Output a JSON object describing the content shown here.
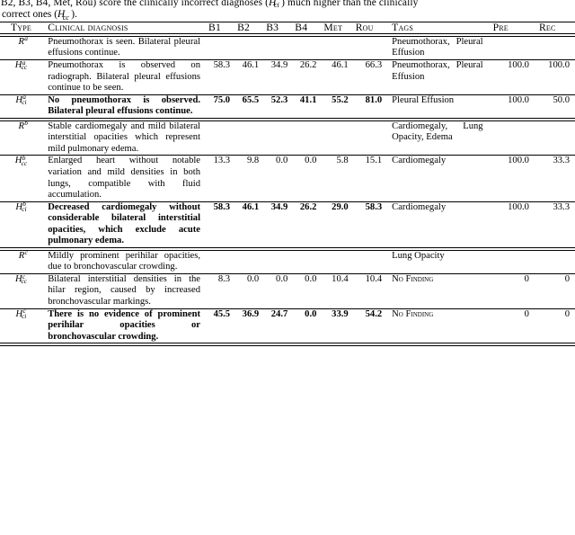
{
  "caption": {
    "line1": "B2, B3, B4, Met, Rou) score the clinically incorrect diagnoses (",
    "line1_sym": "H",
    "line1_sub": "ci",
    "line1_tail": ") much higher than the clinically",
    "line2_head": "correct ones (",
    "line2_sym": "H",
    "line2_sub": "cc",
    "line2_tail": ")."
  },
  "table": {
    "headers": {
      "type": "Type",
      "diagnosis": "Clinical diagnosis",
      "b1": "B1",
      "b2": "B2",
      "b3": "B3",
      "b4": "B4",
      "met": "Met",
      "rou": "Rou",
      "tags": "Tags",
      "pre": "Pre",
      "rec": "Rec"
    },
    "rows": [
      {
        "type_sym": "R",
        "type_sup": "a",
        "type_sub": "",
        "diagnosis": "Pneumothorax is seen. Bilateral pleural effusions continue.",
        "b1": "",
        "b2": "",
        "b3": "",
        "b4": "",
        "met": "",
        "rou": "",
        "tags": "Pneumothorax, Pleural Effusion",
        "pre": "",
        "rec": "",
        "bold": false
      },
      {
        "type_sym": "H",
        "type_sup": "a",
        "type_sub": "cc",
        "diagnosis": "Pneumothorax is observed on radiograph. Bilateral pleural effusions continue to be seen.",
        "b1": "58.3",
        "b2": "46.1",
        "b3": "34.9",
        "b4": "26.2",
        "met": "46.1",
        "rou": "66.3",
        "tags": "Pneumothorax, Pleural Effusion",
        "pre": "100.0",
        "rec": "100.0",
        "bold": false
      },
      {
        "type_sym": "H",
        "type_sup": "a",
        "type_sub": "ci",
        "diagnosis": "No pneumothorax is observed. Bilateral pleural effusions continue.",
        "b1": "75.0",
        "b2": "65.5",
        "b3": "52.3",
        "b4": "41.1",
        "met": "55.2",
        "rou": "81.0",
        "tags": "Pleural Effusion",
        "pre": "100.0",
        "rec": "50.0",
        "bold": true
      },
      {
        "type_sym": "R",
        "type_sup": "b",
        "type_sub": "",
        "diagnosis": "Stable cardiomegaly and mild bilateral interstitial opacities which represent mild pulmonary edema.",
        "b1": "",
        "b2": "",
        "b3": "",
        "b4": "",
        "met": "",
        "rou": "",
        "tags": "Cardiomegaly, Lung Opacity, Edema",
        "pre": "",
        "rec": "",
        "bold": false
      },
      {
        "type_sym": "H",
        "type_sup": "b",
        "type_sub": "cc",
        "diagnosis": "Enlarged heart without notable variation and mild densities in both lungs, compatible with fluid accumulation.",
        "b1": "13.3",
        "b2": "9.8",
        "b3": "0.0",
        "b4": "0.0",
        "met": "5.8",
        "rou": "15.1",
        "tags": "Cardiomegaly",
        "pre": "100.0",
        "rec": "33.3",
        "bold": false
      },
      {
        "type_sym": "H",
        "type_sup": "b",
        "type_sub": "ci",
        "diagnosis": "Decreased cardiomegaly without considerable bilateral interstitial opacities, which exclude acute pulmonary edema.",
        "b1": "58.3",
        "b2": "46.1",
        "b3": "34.9",
        "b4": "26.2",
        "met": "29.0",
        "rou": "58.3",
        "tags": "Cardiomegaly",
        "pre": "100.0",
        "rec": "33.3",
        "bold": true
      },
      {
        "type_sym": "R",
        "type_sup": "c",
        "type_sub": "",
        "diagnosis": "Mildly prominent perihilar opacities, due to bronchovascular crowding.",
        "b1": "",
        "b2": "",
        "b3": "",
        "b4": "",
        "met": "",
        "rou": "",
        "tags": "Lung Opacity",
        "pre": "",
        "rec": "",
        "bold": false
      },
      {
        "type_sym": "H",
        "type_sup": "c",
        "type_sub": "cc",
        "diagnosis": "Bilateral interstitial densities in the hilar region, caused by increased bronchovascular markings.",
        "b1": "8.3",
        "b2": "0.0",
        "b3": "0.0",
        "b4": "0.0",
        "met": "10.4",
        "rou": "10.4",
        "tags": "No Finding",
        "tags_smallcaps": true,
        "pre": "0",
        "rec": "0",
        "bold": false
      },
      {
        "type_sym": "H",
        "type_sup": "c",
        "type_sub": "ci",
        "diagnosis": "There is no evidence of prominent perihilar opacities or bronchovascular crowding.",
        "b1": "45.5",
        "b2": "36.9",
        "b3": "24.7",
        "b4": "0.0",
        "met": "33.9",
        "rou": "54.2",
        "tags": "No Finding",
        "tags_smallcaps": true,
        "pre": "0",
        "rec": "0",
        "bold": true
      }
    ]
  }
}
